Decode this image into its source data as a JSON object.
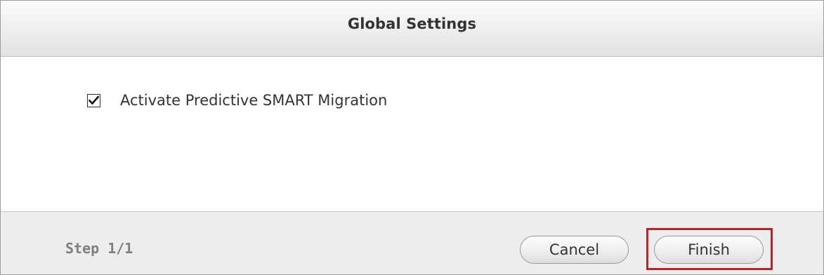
{
  "dialog": {
    "title": "Global Settings",
    "option": {
      "label": "Activate Predictive SMART Migration",
      "checked": true
    },
    "footer": {
      "step": "Step 1/1",
      "cancel_label": "Cancel",
      "finish_label": "Finish",
      "finish_highlighted": true,
      "highlight_color": "#b0272b"
    }
  },
  "icons": {
    "checkbox_mark": "checkmark-icon"
  }
}
